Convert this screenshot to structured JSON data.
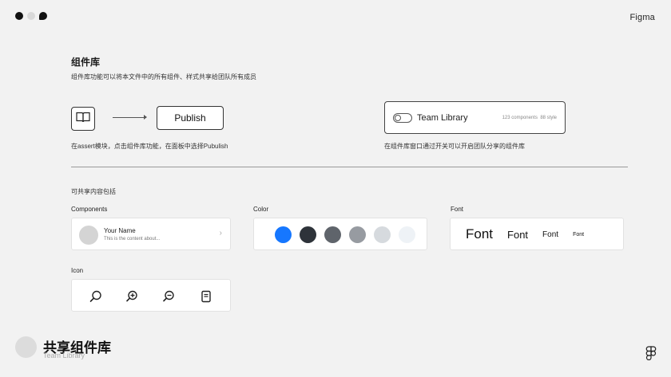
{
  "window": {
    "brand": "Figma"
  },
  "header": {
    "title": "组件库",
    "subtitle": "组件库功能可以将本文件中的所有组件、样式共享给团队所有成员"
  },
  "steps": {
    "left": {
      "icon": "book-icon",
      "button_label": "Publish",
      "description": "在assert模块，点击组件库功能，在面板中选择Pubulish"
    },
    "right": {
      "label": "Team Library",
      "components": "123 components",
      "styles": "88 style",
      "description": "在组件库窗口通过开关可以开启团队分享的组件库"
    }
  },
  "shared": {
    "title": "可共享内容包括",
    "components": {
      "label": "Components",
      "name": "Your Name",
      "desc": "This is the content about...",
      "chevron": "›"
    },
    "color": {
      "label": "Color",
      "swatches": [
        "#1677ff",
        "#2e333a",
        "#5f646b",
        "#979ba1",
        "#d6dade",
        "#eef2f6"
      ]
    },
    "font": {
      "label": "Font",
      "samples": [
        "Font",
        "Font",
        "Font",
        "Font"
      ]
    },
    "icon": {
      "label": "Icon",
      "icons": [
        "search-icon",
        "zoom-in-icon",
        "zoom-out-icon",
        "document-icon"
      ]
    }
  },
  "footer": {
    "title_cn": "共享组件库",
    "title_en": "Team Library",
    "logo": "figma-logo-icon"
  }
}
